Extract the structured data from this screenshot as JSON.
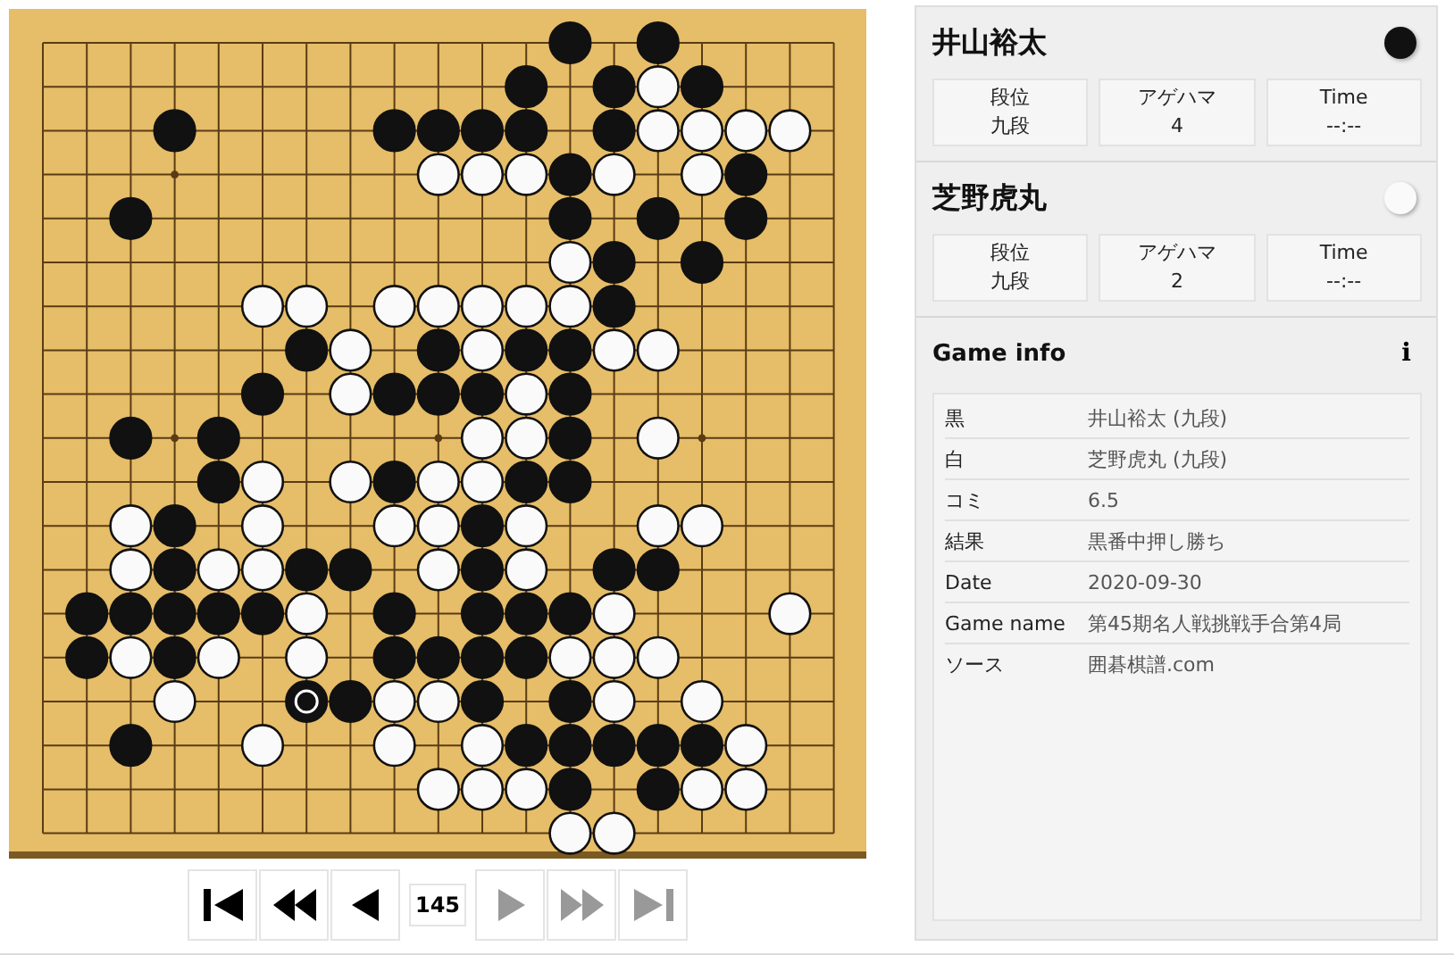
{
  "board": {
    "rows": [
      [
        {
          "kind": "empty"
        },
        {
          "kind": "empty"
        },
        {
          "kind": "empty"
        },
        {
          "kind": "empty"
        },
        {
          "kind": "empty"
        },
        {
          "kind": "empty"
        },
        {
          "kind": "empty"
        },
        {
          "kind": "empty"
        },
        {
          "kind": "empty"
        },
        {
          "kind": "empty"
        },
        {
          "kind": "empty"
        },
        {
          "kind": "empty"
        },
        {
          "kind": "black"
        },
        {
          "kind": "empty"
        },
        {
          "kind": "black"
        },
        {
          "kind": "empty"
        },
        {
          "kind": "empty"
        },
        {
          "kind": "empty"
        },
        {
          "kind": "empty"
        }
      ],
      [
        {
          "kind": "empty"
        },
        {
          "kind": "empty"
        },
        {
          "kind": "empty"
        },
        {
          "kind": "empty"
        },
        {
          "kind": "empty"
        },
        {
          "kind": "empty"
        },
        {
          "kind": "empty"
        },
        {
          "kind": "empty"
        },
        {
          "kind": "empty"
        },
        {
          "kind": "empty"
        },
        {
          "kind": "empty"
        },
        {
          "kind": "black"
        },
        {
          "kind": "empty"
        },
        {
          "kind": "black"
        },
        {
          "kind": "white"
        },
        {
          "kind": "black"
        },
        {
          "kind": "empty"
        },
        {
          "kind": "empty"
        },
        {
          "kind": "empty"
        }
      ],
      [
        {
          "kind": "empty"
        },
        {
          "kind": "empty"
        },
        {
          "kind": "empty"
        },
        {
          "kind": "black"
        },
        {
          "kind": "empty"
        },
        {
          "kind": "empty"
        },
        {
          "kind": "empty"
        },
        {
          "kind": "empty"
        },
        {
          "kind": "black"
        },
        {
          "kind": "black"
        },
        {
          "kind": "black"
        },
        {
          "kind": "black"
        },
        {
          "kind": "empty"
        },
        {
          "kind": "black"
        },
        {
          "kind": "white"
        },
        {
          "kind": "white"
        },
        {
          "kind": "white"
        },
        {
          "kind": "white"
        },
        {
          "kind": "empty"
        }
      ],
      [
        {
          "kind": "empty"
        },
        {
          "kind": "empty"
        },
        {
          "kind": "empty"
        },
        {
          "kind": "empty"
        },
        {
          "kind": "empty"
        },
        {
          "kind": "empty"
        },
        {
          "kind": "empty"
        },
        {
          "kind": "empty"
        },
        {
          "kind": "empty"
        },
        {
          "kind": "white"
        },
        {
          "kind": "white"
        },
        {
          "kind": "white"
        },
        {
          "kind": "black"
        },
        {
          "kind": "white"
        },
        {
          "kind": "empty"
        },
        {
          "kind": "white"
        },
        {
          "kind": "black"
        },
        {
          "kind": "empty"
        },
        {
          "kind": "empty"
        }
      ],
      [
        {
          "kind": "empty"
        },
        {
          "kind": "empty"
        },
        {
          "kind": "black"
        },
        {
          "kind": "empty"
        },
        {
          "kind": "empty"
        },
        {
          "kind": "empty"
        },
        {
          "kind": "empty"
        },
        {
          "kind": "empty"
        },
        {
          "kind": "empty"
        },
        {
          "kind": "empty"
        },
        {
          "kind": "empty"
        },
        {
          "kind": "empty"
        },
        {
          "kind": "black"
        },
        {
          "kind": "empty"
        },
        {
          "kind": "black"
        },
        {
          "kind": "empty"
        },
        {
          "kind": "black"
        },
        {
          "kind": "empty"
        },
        {
          "kind": "empty"
        }
      ],
      [
        {
          "kind": "empty"
        },
        {
          "kind": "empty"
        },
        {
          "kind": "empty"
        },
        {
          "kind": "empty"
        },
        {
          "kind": "empty"
        },
        {
          "kind": "empty"
        },
        {
          "kind": "empty"
        },
        {
          "kind": "empty"
        },
        {
          "kind": "empty"
        },
        {
          "kind": "empty"
        },
        {
          "kind": "empty"
        },
        {
          "kind": "empty"
        },
        {
          "kind": "white"
        },
        {
          "kind": "black"
        },
        {
          "kind": "empty"
        },
        {
          "kind": "black"
        },
        {
          "kind": "empty"
        },
        {
          "kind": "empty"
        },
        {
          "kind": "empty"
        }
      ],
      [
        {
          "kind": "empty"
        },
        {
          "kind": "empty"
        },
        {
          "kind": "empty"
        },
        {
          "kind": "empty"
        },
        {
          "kind": "empty"
        },
        {
          "kind": "white"
        },
        {
          "kind": "white"
        },
        {
          "kind": "empty"
        },
        {
          "kind": "white"
        },
        {
          "kind": "white"
        },
        {
          "kind": "white"
        },
        {
          "kind": "white"
        },
        {
          "kind": "white"
        },
        {
          "kind": "black"
        },
        {
          "kind": "empty"
        },
        {
          "kind": "empty"
        },
        {
          "kind": "empty"
        },
        {
          "kind": "empty"
        },
        {
          "kind": "empty"
        }
      ],
      [
        {
          "kind": "empty"
        },
        {
          "kind": "empty"
        },
        {
          "kind": "empty"
        },
        {
          "kind": "empty"
        },
        {
          "kind": "empty"
        },
        {
          "kind": "empty"
        },
        {
          "kind": "black"
        },
        {
          "kind": "white"
        },
        {
          "kind": "empty"
        },
        {
          "kind": "black"
        },
        {
          "kind": "white"
        },
        {
          "kind": "black"
        },
        {
          "kind": "black"
        },
        {
          "kind": "white"
        },
        {
          "kind": "white"
        },
        {
          "kind": "empty"
        },
        {
          "kind": "empty"
        },
        {
          "kind": "empty"
        },
        {
          "kind": "empty"
        }
      ],
      [
        {
          "kind": "empty"
        },
        {
          "kind": "empty"
        },
        {
          "kind": "empty"
        },
        {
          "kind": "empty"
        },
        {
          "kind": "empty"
        },
        {
          "kind": "black"
        },
        {
          "kind": "empty"
        },
        {
          "kind": "white"
        },
        {
          "kind": "black"
        },
        {
          "kind": "black"
        },
        {
          "kind": "black"
        },
        {
          "kind": "white"
        },
        {
          "kind": "black"
        },
        {
          "kind": "empty"
        },
        {
          "kind": "empty"
        },
        {
          "kind": "empty"
        },
        {
          "kind": "empty"
        },
        {
          "kind": "empty"
        },
        {
          "kind": "empty"
        }
      ],
      [
        {
          "kind": "empty"
        },
        {
          "kind": "empty"
        },
        {
          "kind": "black"
        },
        {
          "kind": "empty"
        },
        {
          "kind": "black"
        },
        {
          "kind": "empty"
        },
        {
          "kind": "empty"
        },
        {
          "kind": "empty"
        },
        {
          "kind": "empty"
        },
        {
          "kind": "empty"
        },
        {
          "kind": "white"
        },
        {
          "kind": "white"
        },
        {
          "kind": "black"
        },
        {
          "kind": "empty"
        },
        {
          "kind": "white"
        },
        {
          "kind": "empty"
        },
        {
          "kind": "empty"
        },
        {
          "kind": "empty"
        },
        {
          "kind": "empty"
        }
      ],
      [
        {
          "kind": "empty"
        },
        {
          "kind": "empty"
        },
        {
          "kind": "empty"
        },
        {
          "kind": "empty"
        },
        {
          "kind": "black"
        },
        {
          "kind": "white"
        },
        {
          "kind": "empty"
        },
        {
          "kind": "white"
        },
        {
          "kind": "black"
        },
        {
          "kind": "white"
        },
        {
          "kind": "white"
        },
        {
          "kind": "black"
        },
        {
          "kind": "black"
        },
        {
          "kind": "empty"
        },
        {
          "kind": "empty"
        },
        {
          "kind": "empty"
        },
        {
          "kind": "empty"
        },
        {
          "kind": "empty"
        },
        {
          "kind": "empty"
        }
      ],
      [
        {
          "kind": "empty"
        },
        {
          "kind": "empty"
        },
        {
          "kind": "white"
        },
        {
          "kind": "black"
        },
        {
          "kind": "empty"
        },
        {
          "kind": "white"
        },
        {
          "kind": "empty"
        },
        {
          "kind": "empty"
        },
        {
          "kind": "white"
        },
        {
          "kind": "white"
        },
        {
          "kind": "black"
        },
        {
          "kind": "white"
        },
        {
          "kind": "empty"
        },
        {
          "kind": "empty"
        },
        {
          "kind": "white"
        },
        {
          "kind": "white"
        },
        {
          "kind": "empty"
        },
        {
          "kind": "empty"
        },
        {
          "kind": "empty"
        }
      ],
      [
        {
          "kind": "empty"
        },
        {
          "kind": "empty"
        },
        {
          "kind": "white"
        },
        {
          "kind": "black"
        },
        {
          "kind": "white"
        },
        {
          "kind": "white"
        },
        {
          "kind": "black"
        },
        {
          "kind": "black"
        },
        {
          "kind": "empty"
        },
        {
          "kind": "white"
        },
        {
          "kind": "black"
        },
        {
          "kind": "white"
        },
        {
          "kind": "empty"
        },
        {
          "kind": "black"
        },
        {
          "kind": "black"
        },
        {
          "kind": "empty"
        },
        {
          "kind": "empty"
        },
        {
          "kind": "empty"
        },
        {
          "kind": "empty"
        }
      ],
      [
        {
          "kind": "empty"
        },
        {
          "kind": "black"
        },
        {
          "kind": "black"
        },
        {
          "kind": "black"
        },
        {
          "kind": "black"
        },
        {
          "kind": "black"
        },
        {
          "kind": "white"
        },
        {
          "kind": "empty"
        },
        {
          "kind": "black"
        },
        {
          "kind": "empty"
        },
        {
          "kind": "black"
        },
        {
          "kind": "black"
        },
        {
          "kind": "black"
        },
        {
          "kind": "white"
        },
        {
          "kind": "empty"
        },
        {
          "kind": "empty"
        },
        {
          "kind": "empty"
        },
        {
          "kind": "white"
        },
        {
          "kind": "empty"
        }
      ],
      [
        {
          "kind": "empty"
        },
        {
          "kind": "black"
        },
        {
          "kind": "white"
        },
        {
          "kind": "black"
        },
        {
          "kind": "white"
        },
        {
          "kind": "empty"
        },
        {
          "kind": "white"
        },
        {
          "kind": "empty"
        },
        {
          "kind": "black"
        },
        {
          "kind": "black"
        },
        {
          "kind": "black"
        },
        {
          "kind": "black"
        },
        {
          "kind": "white"
        },
        {
          "kind": "white"
        },
        {
          "kind": "white"
        },
        {
          "kind": "empty"
        },
        {
          "kind": "empty"
        },
        {
          "kind": "empty"
        },
        {
          "kind": "empty"
        }
      ],
      [
        {
          "kind": "empty"
        },
        {
          "kind": "empty"
        },
        {
          "kind": "empty"
        },
        {
          "kind": "white"
        },
        {
          "kind": "empty"
        },
        {
          "kind": "empty"
        },
        {
          "kind": "black_last"
        },
        {
          "kind": "black"
        },
        {
          "kind": "white"
        },
        {
          "kind": "white"
        },
        {
          "kind": "black"
        },
        {
          "kind": "empty"
        },
        {
          "kind": "black"
        },
        {
          "kind": "white"
        },
        {
          "kind": "empty"
        },
        {
          "kind": "white"
        },
        {
          "kind": "empty"
        },
        {
          "kind": "empty"
        },
        {
          "kind": "empty"
        }
      ],
      [
        {
          "kind": "empty"
        },
        {
          "kind": "empty"
        },
        {
          "kind": "black"
        },
        {
          "kind": "empty"
        },
        {
          "kind": "empty"
        },
        {
          "kind": "white"
        },
        {
          "kind": "empty"
        },
        {
          "kind": "empty"
        },
        {
          "kind": "white"
        },
        {
          "kind": "empty"
        },
        {
          "kind": "white"
        },
        {
          "kind": "black"
        },
        {
          "kind": "black"
        },
        {
          "kind": "black"
        },
        {
          "kind": "black"
        },
        {
          "kind": "black"
        },
        {
          "kind": "white"
        },
        {
          "kind": "empty"
        },
        {
          "kind": "empty"
        }
      ],
      [
        {
          "kind": "empty"
        },
        {
          "kind": "empty"
        },
        {
          "kind": "empty"
        },
        {
          "kind": "empty"
        },
        {
          "kind": "empty"
        },
        {
          "kind": "empty"
        },
        {
          "kind": "empty"
        },
        {
          "kind": "empty"
        },
        {
          "kind": "empty"
        },
        {
          "kind": "white"
        },
        {
          "kind": "white"
        },
        {
          "kind": "white"
        },
        {
          "kind": "black"
        },
        {
          "kind": "empty"
        },
        {
          "kind": "black"
        },
        {
          "kind": "white"
        },
        {
          "kind": "white"
        },
        {
          "kind": "empty"
        },
        {
          "kind": "empty"
        }
      ],
      [
        {
          "kind": "empty"
        },
        {
          "kind": "empty"
        },
        {
          "kind": "empty"
        },
        {
          "kind": "empty"
        },
        {
          "kind": "empty"
        },
        {
          "kind": "empty"
        },
        {
          "kind": "empty"
        },
        {
          "kind": "empty"
        },
        {
          "kind": "empty"
        },
        {
          "kind": "empty"
        },
        {
          "kind": "empty"
        },
        {
          "kind": "empty"
        },
        {
          "kind": "white"
        },
        {
          "kind": "white"
        },
        {
          "kind": "empty"
        },
        {
          "kind": "empty"
        },
        {
          "kind": "empty"
        },
        {
          "kind": "empty"
        },
        {
          "kind": "empty"
        }
      ]
    ]
  },
  "navigation": {
    "buttons": [
      {
        "kind": "first",
        "disabled": false
      },
      {
        "kind": "back10",
        "disabled": false
      },
      {
        "kind": "back",
        "disabled": false
      },
      {
        "kind": "move",
        "label": "145"
      },
      {
        "kind": "forward",
        "disabled": true
      },
      {
        "kind": "forward10",
        "disabled": true
      },
      {
        "kind": "last",
        "disabled": true
      }
    ]
  },
  "players": [
    {
      "name": "井山裕太",
      "kind": "black",
      "stats": [
        {
          "label": "段位",
          "value": "九段"
        },
        {
          "label": "アゲハマ",
          "value": "4"
        },
        {
          "label": "Time",
          "value": "--:--"
        }
      ]
    },
    {
      "name": "芝野虎丸",
      "kind": "white",
      "stats": [
        {
          "label": "段位",
          "value": "九段"
        },
        {
          "label": "アゲハマ",
          "value": "2"
        },
        {
          "label": "Time",
          "value": "--:--"
        }
      ]
    }
  ],
  "game_info": {
    "title": "Game info",
    "icon": "i",
    "rows": [
      {
        "label": "黒",
        "value": "井山裕太 (九段)"
      },
      {
        "label": "白",
        "value": "芝野虎丸 (九段)"
      },
      {
        "label": "コミ",
        "value": "6.5"
      },
      {
        "label": "結果",
        "value": "黒番中押し勝ち"
      },
      {
        "label": "Date",
        "value": "2020-09-30"
      },
      {
        "label": "Game name",
        "value": "第45期名人戦挑戦手合第4局"
      },
      {
        "label": "ソース",
        "value": "囲碁棋譜.com"
      }
    ]
  }
}
